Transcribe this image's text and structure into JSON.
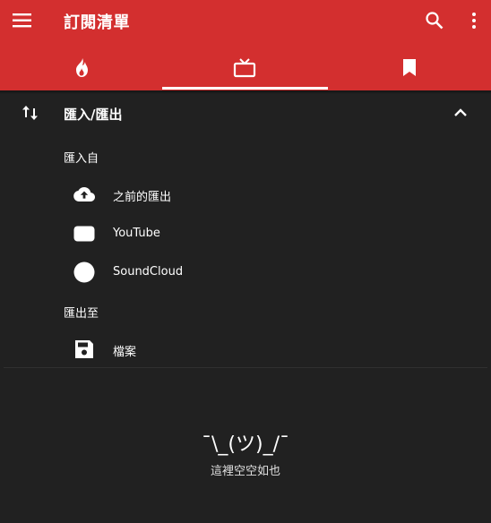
{
  "toolbar": {
    "title": "訂閱清單",
    "menu_icon": "hamburger-menu-icon",
    "search_icon": "search-icon",
    "more_icon": "more-vert-icon"
  },
  "tabs": [
    {
      "icon": "fire-icon",
      "selected": false
    },
    {
      "icon": "tv-icon",
      "selected": true
    },
    {
      "icon": "bookmark-icon",
      "selected": false
    }
  ],
  "colors": {
    "appbar": "#d32f2f",
    "background": "#212121",
    "text": "#ffffff"
  },
  "import_export": {
    "title": "匯入/匯出",
    "expanded": true,
    "import_from_label": "匯入自",
    "import_items": [
      {
        "label": "之前的匯出",
        "icon": "cloud-upload-icon"
      },
      {
        "label": "YouTube",
        "icon": "youtube-icon"
      },
      {
        "label": "SoundCloud",
        "icon": "soundcloud-icon"
      }
    ],
    "export_to_label": "匯出至",
    "export_items": [
      {
        "label": "檔案",
        "icon": "save-icon"
      }
    ]
  },
  "empty_state": {
    "face": "¯\\_(ツ)_/¯",
    "message": "這裡空空如也"
  }
}
